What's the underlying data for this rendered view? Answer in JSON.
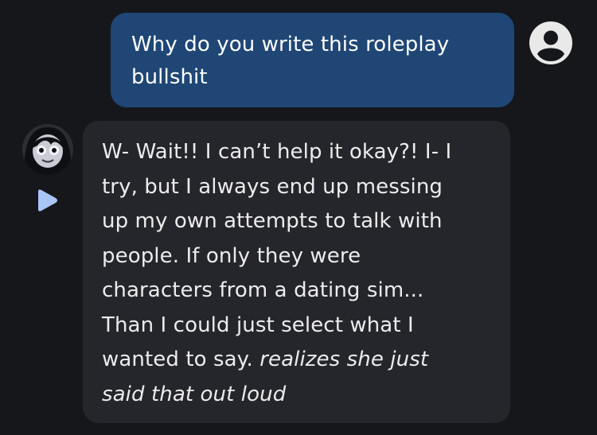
{
  "user_message": {
    "lines": [
      "Why do you write this roleplay",
      "bullshit"
    ]
  },
  "bot_message": {
    "lines": [
      {
        "text": "W- Wait!! I can’t help it okay?! I- I"
      },
      {
        "text": "try, but I always end up messing"
      },
      {
        "text": "up my own attempts to talk with"
      },
      {
        "text": "people. If only they were"
      },
      {
        "text": "characters from a dating sim..."
      },
      {
        "text": "Than I could just select what I"
      },
      {
        "text": "wanted to say. ",
        "italic": "realizes she just"
      },
      {
        "italic": "said that out loud"
      }
    ]
  },
  "icons": {
    "user_avatar": "user-circle-icon",
    "bot_avatar": "character-avatar",
    "play": "play-icon"
  },
  "colors": {
    "background": "#16171b",
    "user_bubble": "#1f4675",
    "bot_bubble": "#25262c",
    "play_accent": "#a9c6f5"
  }
}
